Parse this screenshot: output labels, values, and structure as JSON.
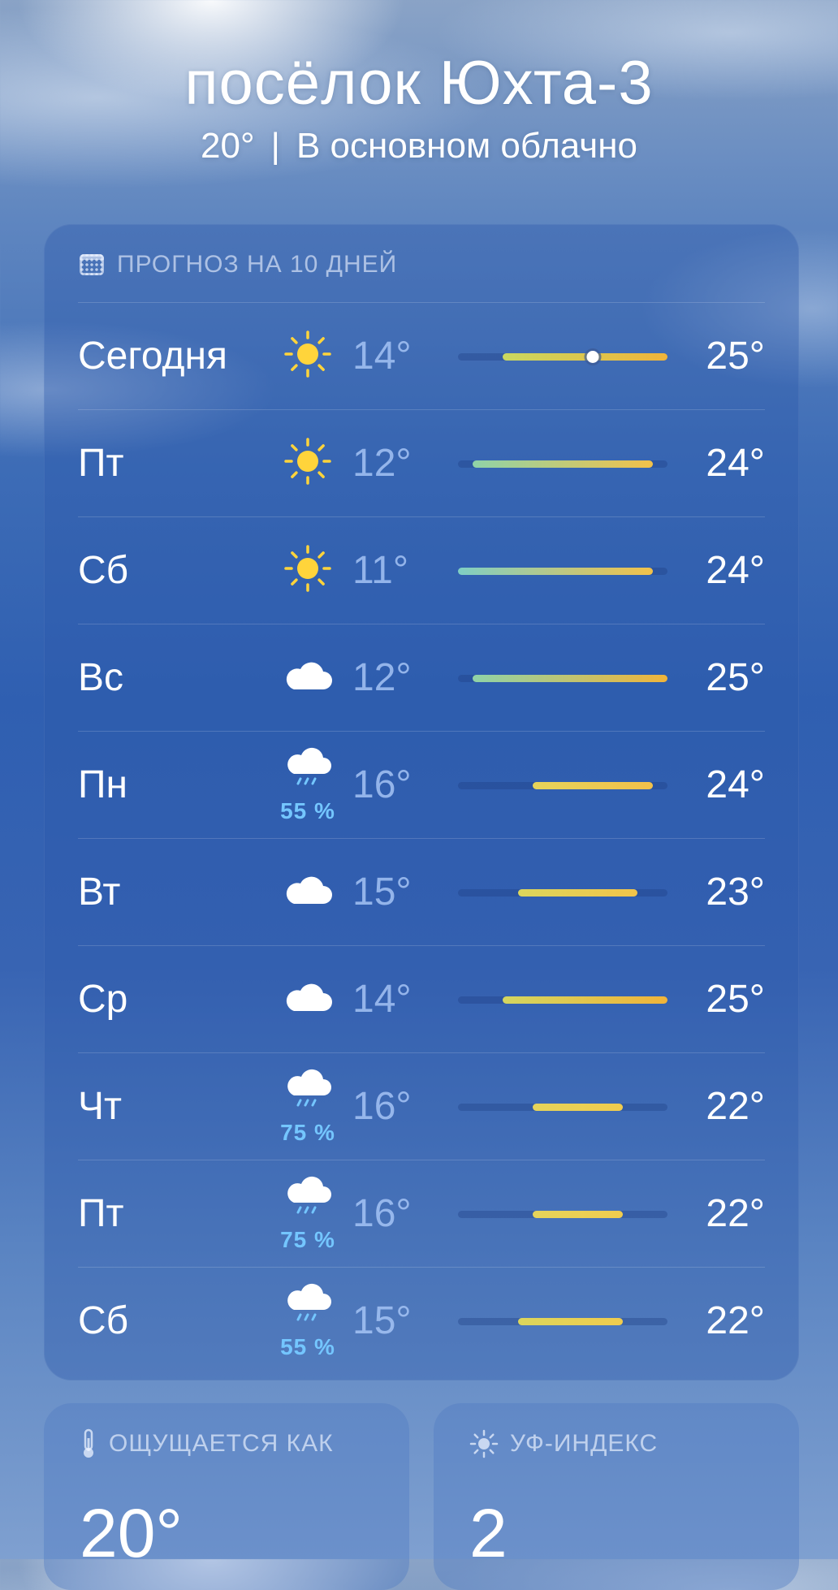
{
  "location": {
    "city": "посёлок Юхта-3",
    "current_temp": "20°",
    "separator": "|",
    "condition": "В основном облачно"
  },
  "forecast": {
    "title": "ПРОГНОЗ НА 10 ДНЕЙ",
    "title_icon": "calendar-icon",
    "range_min": 11,
    "range_max": 25,
    "current_temp_value": 20,
    "days": [
      {
        "day": "Сегодня",
        "icon": "sun-icon",
        "precip": "",
        "low": "14°",
        "high": "25°",
        "low_value": 14,
        "high_value": 25,
        "gradient": [
          "#c9d860",
          "#f0b43a"
        ],
        "is_today": true
      },
      {
        "day": "Пт",
        "icon": "sun-icon",
        "precip": "",
        "low": "12°",
        "high": "24°",
        "low_value": 12,
        "high_value": 24,
        "gradient": [
          "#8fd3a8",
          "#f2c14a"
        ],
        "is_today": false
      },
      {
        "day": "Сб",
        "icon": "sun-icon",
        "precip": "",
        "low": "11°",
        "high": "24°",
        "low_value": 11,
        "high_value": 24,
        "gradient": [
          "#7fcfc4",
          "#f2c14a"
        ],
        "is_today": false
      },
      {
        "day": "Вс",
        "icon": "cloud-icon",
        "precip": "",
        "low": "12°",
        "high": "25°",
        "low_value": 12,
        "high_value": 25,
        "gradient": [
          "#8fd3a8",
          "#f0b43a"
        ],
        "is_today": false
      },
      {
        "day": "Пн",
        "icon": "cloud-rain-icon",
        "precip": "55 %",
        "low": "16°",
        "high": "24°",
        "low_value": 16,
        "high_value": 24,
        "gradient": [
          "#e6d45a",
          "#f2c14a"
        ],
        "is_today": false
      },
      {
        "day": "Вт",
        "icon": "cloud-icon",
        "precip": "",
        "low": "15°",
        "high": "23°",
        "low_value": 15,
        "high_value": 23,
        "gradient": [
          "#dcd65c",
          "#f2c44a"
        ],
        "is_today": false
      },
      {
        "day": "Ср",
        "icon": "cloud-icon",
        "precip": "",
        "low": "14°",
        "high": "25°",
        "low_value": 14,
        "high_value": 25,
        "gradient": [
          "#d4d660",
          "#f0b43a"
        ],
        "is_today": false
      },
      {
        "day": "Чт",
        "icon": "cloud-rain-icon",
        "precip": "75 %",
        "low": "16°",
        "high": "22°",
        "low_value": 16,
        "high_value": 22,
        "gradient": [
          "#e6d45a",
          "#f0cc4e"
        ],
        "is_today": false
      },
      {
        "day": "Пт",
        "icon": "cloud-rain-icon",
        "precip": "75 %",
        "low": "16°",
        "high": "22°",
        "low_value": 16,
        "high_value": 22,
        "gradient": [
          "#e6d45a",
          "#f0cc4e"
        ],
        "is_today": false
      },
      {
        "day": "Сб",
        "icon": "cloud-rain-icon",
        "precip": "55 %",
        "low": "15°",
        "high": "22°",
        "low_value": 15,
        "high_value": 22,
        "gradient": [
          "#dcd65c",
          "#f0cc4e"
        ],
        "is_today": false
      }
    ]
  },
  "feels_like": {
    "title": "ОЩУЩАЕТСЯ КАК",
    "icon": "thermometer-icon",
    "value": "20°"
  },
  "uv_index": {
    "title": "УФ-ИНДЕКС",
    "icon": "sun-icon",
    "value": "2"
  },
  "colors": {
    "precip_text": "#74c6ff",
    "sun": "#ffd43b",
    "low_temp_text": "#a5c3f5"
  }
}
